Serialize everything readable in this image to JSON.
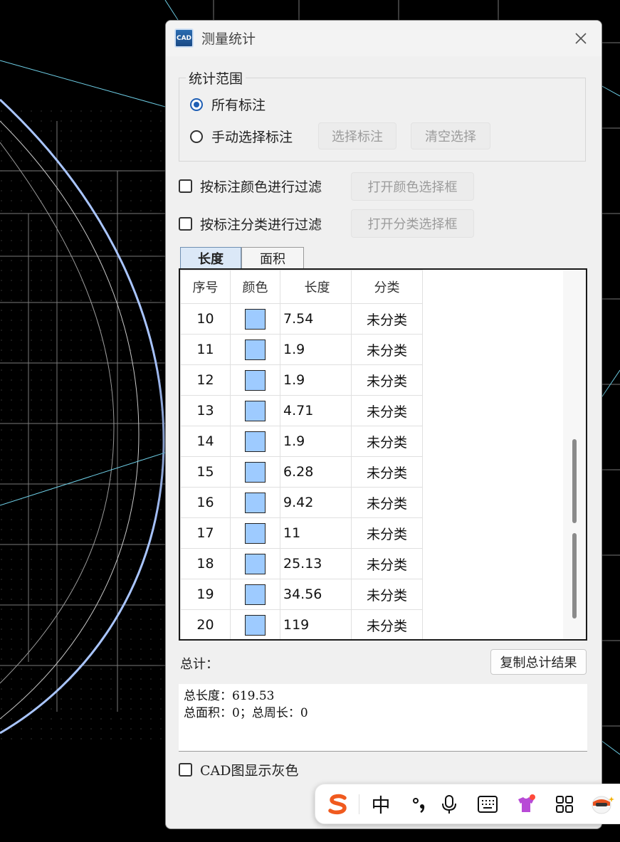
{
  "dialog": {
    "title": "测量统计",
    "app_icon_text": "CAD"
  },
  "scope": {
    "group_title": "统计范围",
    "all_label": "所有标注",
    "manual_label": "手动选择标注",
    "select_button": "选择标注",
    "clear_button": "清空选择",
    "selected": "all"
  },
  "filters": {
    "color_filter_label": "按标注颜色进行过滤",
    "color_dialog_button": "打开颜色选择框",
    "category_filter_label": "按标注分类进行过滤",
    "category_dialog_button": "打开分类选择框"
  },
  "tabs": {
    "length": "长度",
    "area": "面积",
    "active": "length"
  },
  "table": {
    "headers": {
      "index": "序号",
      "color": "颜色",
      "length": "长度",
      "category": "分类"
    },
    "swatch_color": "#9ecbff",
    "rows": [
      {
        "index": "10",
        "length": "7.54",
        "category": "未分类"
      },
      {
        "index": "11",
        "length": "1.9",
        "category": "未分类"
      },
      {
        "index": "12",
        "length": "1.9",
        "category": "未分类"
      },
      {
        "index": "13",
        "length": "4.71",
        "category": "未分类"
      },
      {
        "index": "14",
        "length": "1.9",
        "category": "未分类"
      },
      {
        "index": "15",
        "length": "6.28",
        "category": "未分类"
      },
      {
        "index": "16",
        "length": "9.42",
        "category": "未分类"
      },
      {
        "index": "17",
        "length": "11",
        "category": "未分类"
      },
      {
        "index": "18",
        "length": "25.13",
        "category": "未分类"
      },
      {
        "index": "19",
        "length": "34.56",
        "category": "未分类"
      },
      {
        "index": "20",
        "length": "119",
        "category": "未分类"
      }
    ]
  },
  "totals": {
    "label": "总计：",
    "copy_button": "复制总计结果",
    "line1": "总长度：619.53",
    "line2": "总面积：0；总周长：0"
  },
  "gray_option": {
    "label": "CAD图显示灰色"
  },
  "ime": {
    "lang": "中"
  },
  "icons": {
    "close": "close-icon",
    "sogou": "sogou-logo-icon",
    "punct": "punctuation-icon",
    "mic": "microphone-icon",
    "keyboard": "keyboard-icon",
    "skin": "skin-icon",
    "apps": "apps-grid-icon",
    "assistant": "assistant-icon"
  }
}
